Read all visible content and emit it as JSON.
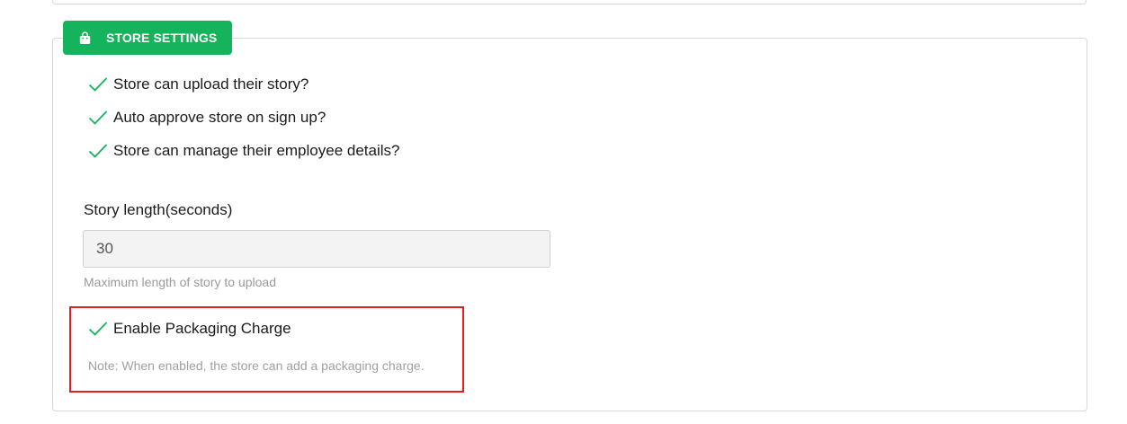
{
  "section": {
    "title": "STORE SETTINGS",
    "icon": "shopping-bag-icon",
    "accent_color": "#15b35b"
  },
  "options": [
    {
      "label": "Store can upload their story?",
      "checked": true
    },
    {
      "label": "Auto approve store on sign up?",
      "checked": true
    },
    {
      "label": "Store can manage their employee details?",
      "checked": true
    }
  ],
  "story_length": {
    "label": "Story length(seconds)",
    "value": "30",
    "help": "Maximum length of story to upload"
  },
  "packaging": {
    "label": "Enable Packaging Charge",
    "checked": true,
    "note": "Note: When enabled, the store can add a packaging charge.",
    "highlight_color": "#e01f1f"
  }
}
